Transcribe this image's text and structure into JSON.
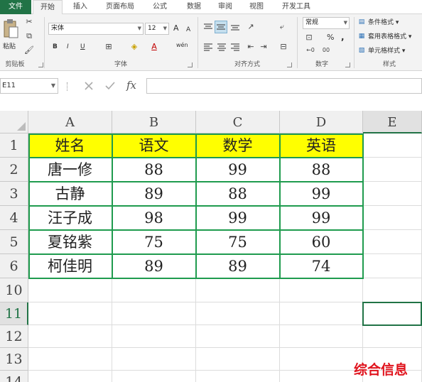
{
  "tabs": [
    "文件",
    "开始",
    "插入",
    "页面布局",
    "公式",
    "数据",
    "审阅",
    "视图",
    "开发工具"
  ],
  "ribbon": {
    "paste_label": "粘贴",
    "clipboard_label": "剪贴板",
    "font_name": "宋体",
    "font_size": "12",
    "font_label": "字体",
    "align_label": "对齐方式",
    "number_format": "常规",
    "number_label": "数字",
    "conditional_format": "条件格式",
    "table_format": "套用表格格式",
    "cell_style": "单元格样式",
    "styles_label": "样式",
    "bold": "B",
    "italic": "I",
    "underline": "U",
    "font_grow": "A",
    "font_shrink": "A",
    "wen": "wén",
    "percent": "%",
    "comma": ","
  },
  "formula_bar": {
    "name_box": "E11",
    "fx": "fx",
    "value": ""
  },
  "sheet": {
    "columns": [
      "A",
      "B",
      "C",
      "D",
      "E"
    ],
    "rows": [
      "1",
      "2",
      "3",
      "4",
      "5",
      "6",
      "10",
      "11",
      "12",
      "13",
      "14"
    ],
    "header": [
      "姓名",
      "语文",
      "数学",
      "英语"
    ],
    "data": [
      [
        "唐一修",
        "88",
        "99",
        "88"
      ],
      [
        "古静",
        "89",
        "88",
        "99"
      ],
      [
        "汪子成",
        "98",
        "99",
        "99"
      ],
      [
        "夏铭紫",
        "75",
        "75",
        "60"
      ],
      [
        "柯佳明",
        "89",
        "89",
        "74"
      ]
    ],
    "selected_cell": "E11"
  },
  "watermark": "综合信息"
}
